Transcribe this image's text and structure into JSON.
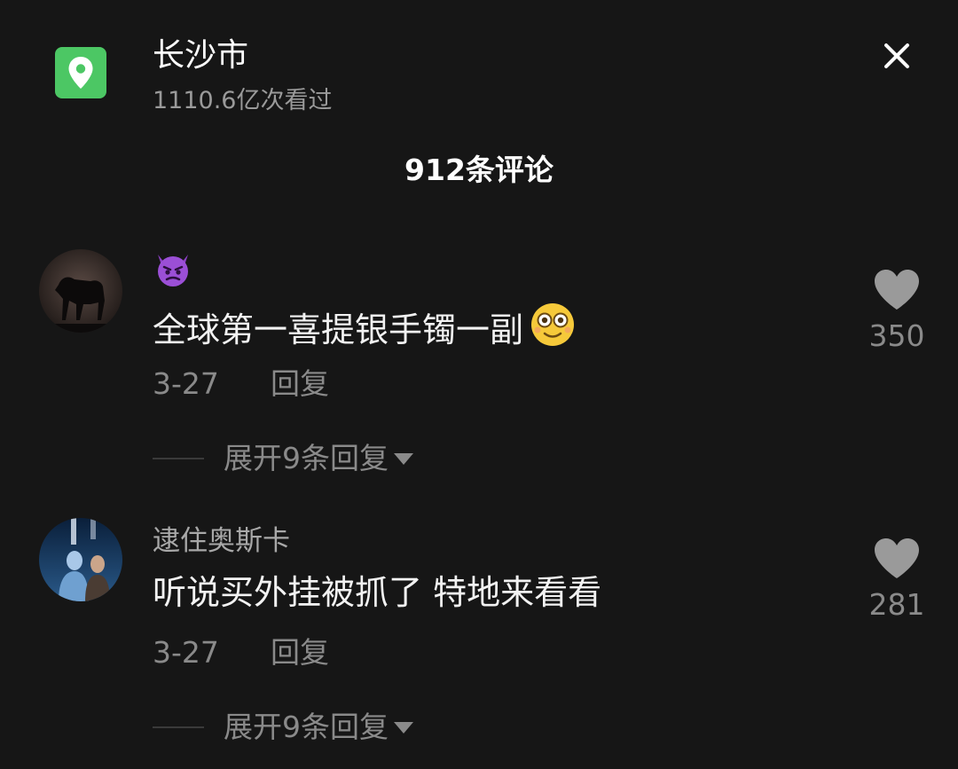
{
  "header": {
    "location_icon": "map-pin-icon",
    "location_icon_color": "#4cc764",
    "location_name": "长沙市",
    "views": "1110.6亿次看过",
    "close_icon": "close-icon"
  },
  "comments_title": "912条评论",
  "comments": [
    {
      "username": "",
      "username_icon": "devil-face-emoji",
      "text": "全球第一喜提银手镯一副",
      "text_emoji": "grinning-face-emoji",
      "date": "3-27",
      "reply_label": "回复",
      "likes": "350",
      "expand_label": "展开9条回复"
    },
    {
      "username": "逮住奥斯卡",
      "text": "听说买外挂被抓了 特地来看看",
      "date": "3-27",
      "reply_label": "回复",
      "likes": "281",
      "expand_label": "展开9条回复"
    }
  ],
  "colors": {
    "background": "#161616",
    "secondary_text": "#8a8a8a"
  }
}
